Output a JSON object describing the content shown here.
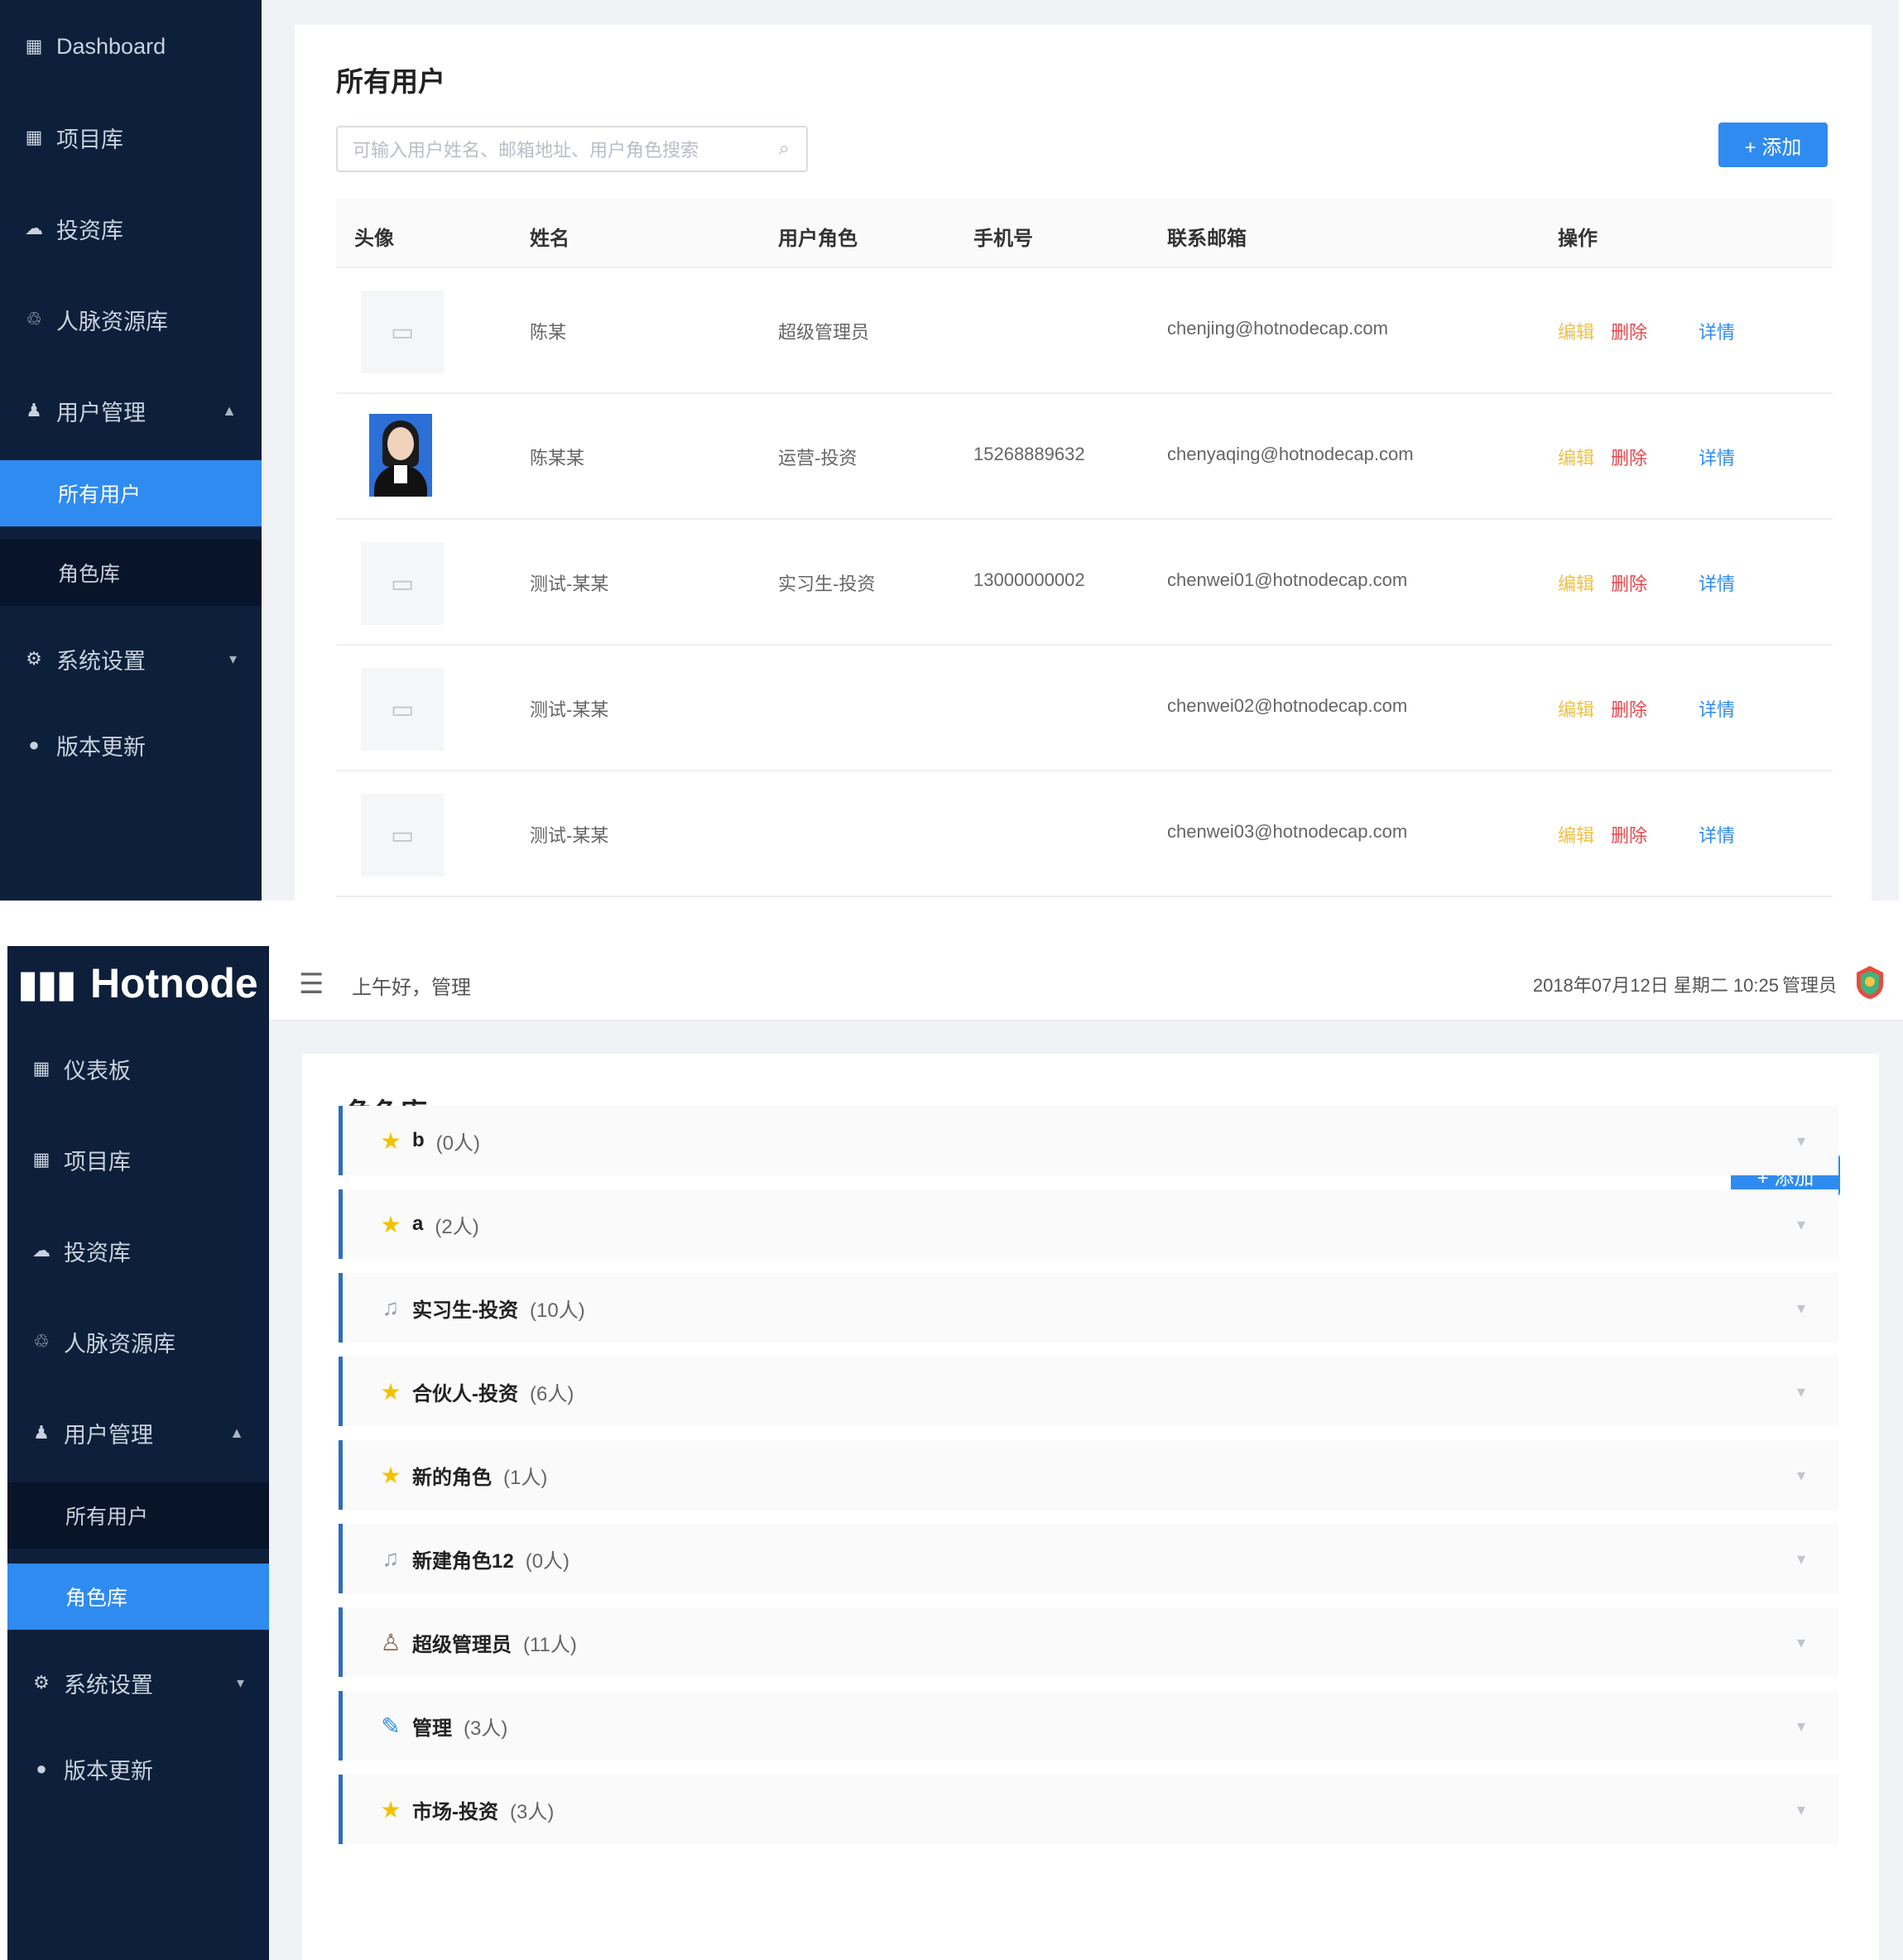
{
  "panel1": {
    "sidebar": {
      "items": [
        {
          "label": "Dashboard",
          "icon": "grid-icon"
        },
        {
          "label": "项目库",
          "icon": "grid-icon"
        },
        {
          "label": "投资库",
          "icon": "cloud-icon"
        },
        {
          "label": "人脉资源库",
          "icon": "network-icon"
        },
        {
          "label": "用户管理",
          "icon": "user-icon",
          "expanded": true
        },
        {
          "label": "系统设置",
          "icon": "gear-icon"
        },
        {
          "label": "版本更新",
          "icon": "update-icon"
        }
      ],
      "sub_items": [
        {
          "label": "所有用户",
          "active": true
        },
        {
          "label": "角色库",
          "active": false
        }
      ]
    },
    "title": "所有用户",
    "search_placeholder": "可输入用户姓名、邮箱地址、用户角色搜索",
    "add_button": "+ 添加",
    "columns": [
      "头像",
      "姓名",
      "用户角色",
      "手机号",
      "联系邮箱",
      "操作"
    ],
    "rows": [
      {
        "name": "陈某",
        "role": "超级管理员",
        "phone": "",
        "email": "chenjing@hotnodecap.com",
        "photo": false
      },
      {
        "name": "陈某某",
        "role": "运营-投资",
        "phone": "15268889632",
        "email": "chenyaqing@hotnodecap.com",
        "photo": true
      },
      {
        "name": "测试-某某",
        "role": "实习生-投资",
        "phone": "13000000002",
        "email": "chenwei01@hotnodecap.com",
        "photo": false
      },
      {
        "name": "测试-某某",
        "role": "",
        "phone": "",
        "email": "chenwei02@hotnodecap.com",
        "photo": false
      },
      {
        "name": "测试-某某",
        "role": "",
        "phone": "",
        "email": "chenwei03@hotnodecap.com",
        "photo": false
      }
    ],
    "actions": {
      "edit": "编辑",
      "delete": "删除",
      "detail": "详情"
    }
  },
  "panel2": {
    "logo": "Hotnode",
    "greeting": "上午好，管理",
    "datetime": "2018年07月12日 星期二 10:25",
    "username": "管理员",
    "sidebar": {
      "items": [
        {
          "label": "仪表板",
          "icon": "grid-icon"
        },
        {
          "label": "项目库",
          "icon": "grid-icon"
        },
        {
          "label": "投资库",
          "icon": "cloud-icon"
        },
        {
          "label": "人脉资源库",
          "icon": "network-icon"
        },
        {
          "label": "用户管理",
          "icon": "user-icon",
          "expanded": true
        },
        {
          "label": "系统设置",
          "icon": "gear-icon"
        },
        {
          "label": "版本更新",
          "icon": "update-icon"
        }
      ],
      "sub_items": [
        {
          "label": "所有用户",
          "active": false
        },
        {
          "label": "角色库",
          "active": true
        }
      ]
    },
    "title": "角色库",
    "add_button": "+ 添加",
    "roles": [
      {
        "icon": "star-icon",
        "name": "b",
        "count": "(0人)"
      },
      {
        "icon": "star-icon",
        "name": "a",
        "count": "(2人)"
      },
      {
        "icon": "music-icon",
        "name": "实习生-投资",
        "count": "(10人)"
      },
      {
        "icon": "star-icon",
        "name": "合伙人-投资",
        "count": "(6人)"
      },
      {
        "icon": "star-icon",
        "name": "新的角色",
        "count": "(1人)"
      },
      {
        "icon": "music-icon",
        "name": "新建角色12",
        "count": "(0人)"
      },
      {
        "icon": "person-icon",
        "name": "超级管理员",
        "count": "(11人)"
      },
      {
        "icon": "pencil-icon",
        "name": "管理",
        "count": "(3人)"
      },
      {
        "icon": "star-icon",
        "name": "市场-投资",
        "count": "(3人)"
      }
    ]
  }
}
